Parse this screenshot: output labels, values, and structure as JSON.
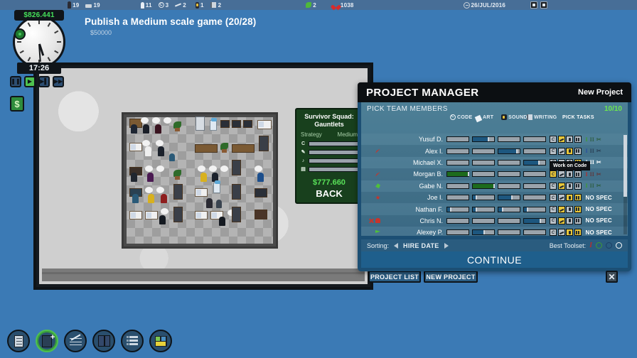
{
  "topbar": {
    "stats": [
      {
        "icon": "person-dark-icon",
        "value": "19"
      },
      {
        "icon": "bed-icon",
        "value": "19"
      },
      {
        "icon": "person-white-icon",
        "value": "11"
      },
      {
        "icon": "code-icon",
        "value": "3"
      },
      {
        "icon": "art-brush-icon",
        "value": "2"
      },
      {
        "icon": "sound-mic-icon",
        "value": "1"
      },
      {
        "icon": "writing-book-icon",
        "value": "2"
      },
      {
        "icon": "leaf-green-icon",
        "value": "2"
      },
      {
        "icon": "heart-red-icon",
        "value": "1038"
      }
    ],
    "date_icon": "clock-circle-icon",
    "date": "26/JUL/2016",
    "right_icons": [
      "save-icon",
      "book-icon"
    ]
  },
  "hud": {
    "money": "$826.441",
    "time": "17:26",
    "speed_buttons": [
      {
        "name": "pause-button",
        "glyph": "❚❚",
        "active": false
      },
      {
        "name": "play-button",
        "glyph": "▶",
        "active": true
      },
      {
        "name": "fast-button",
        "glyph": "▶▌",
        "active": false
      },
      {
        "name": "fastest-button",
        "glyph": "▶▶",
        "active": false
      }
    ],
    "finance_button": "$"
  },
  "objective": {
    "title": "Publish a Medium scale game (20/28)",
    "reward": "$50000"
  },
  "squad": {
    "title_line1": "Survivor Squad:",
    "title_line2": "Gauntlets",
    "genre_label": "Strategy",
    "size_label": "Medium",
    "skills": [
      {
        "label": "C",
        "icon": "code-icon",
        "pct": 52
      },
      {
        "label": "",
        "icon": "art-icon",
        "pct": 12
      },
      {
        "label": "",
        "icon": "sound-icon",
        "pct": 22
      },
      {
        "label": "",
        "icon": "writing-icon",
        "pct": 26
      }
    ],
    "money": "$777.660",
    "back_label": "BACK"
  },
  "project_manager": {
    "title": "PROJECT MANAGER",
    "new_project_label": "New Project",
    "section_label": "PICK TEAM MEMBERS",
    "count": "10/10",
    "columns": [
      {
        "key": "code",
        "label": "CODE",
        "icon": "code-icon"
      },
      {
        "key": "art",
        "label": "ART",
        "icon": "art-brush-icon"
      },
      {
        "key": "sound",
        "label": "SOUND",
        "icon": "sound-mic-icon"
      },
      {
        "key": "writing",
        "label": "WRITING",
        "icon": "writing-book-icon"
      }
    ],
    "pick_tasks_label": "PICK TASKS",
    "tooltip": "Work on Code",
    "members": [
      {
        "name": "Yusuf D.",
        "markers": [],
        "bars": [
          {
            "pct": 0,
            "color": "none"
          },
          {
            "pct": 72,
            "color": "blue"
          },
          {
            "pct": 0,
            "color": "none"
          },
          {
            "pct": 0,
            "color": "none"
          }
        ],
        "tasks": [
          false,
          true,
          false,
          false
        ],
        "spec": {
          "type": "levels",
          "levels": [
            "on",
            "off",
            "off"
          ],
          "color": "green"
        }
      },
      {
        "name": "Alex I.",
        "markers": [
          "rocket"
        ],
        "bars": [
          {
            "pct": 0,
            "color": "none"
          },
          {
            "pct": 0,
            "color": "none"
          },
          {
            "pct": 88,
            "color": "blue"
          },
          {
            "pct": 0,
            "color": "none"
          }
        ],
        "tasks": [
          false,
          false,
          true,
          false
        ],
        "spec": {
          "type": "levels",
          "levels": [
            "on",
            "off",
            "off"
          ],
          "color": "blue"
        }
      },
      {
        "name": "Michael X.",
        "markers": [],
        "bars": [
          {
            "pct": 0,
            "color": "none"
          },
          {
            "pct": 0,
            "color": "none"
          },
          {
            "pct": 0,
            "color": "none"
          },
          {
            "pct": 70,
            "color": "blue"
          }
        ],
        "tasks": [
          false,
          false,
          false,
          true
        ],
        "spec": {
          "type": "levels",
          "levels": [
            "on",
            "on",
            "on"
          ],
          "color": "white"
        }
      },
      {
        "name": "Morgan B.",
        "markers": [
          "rocket"
        ],
        "bars": [
          {
            "pct": 100,
            "color": "green"
          },
          {
            "pct": 0,
            "color": "none"
          },
          {
            "pct": 0,
            "color": "none"
          },
          {
            "pct": 0,
            "color": "none"
          }
        ],
        "tasks": [
          true,
          false,
          false,
          false
        ],
        "spec": {
          "type": "levels",
          "levels": [
            "on",
            "off",
            "off"
          ],
          "color": "red"
        }
      },
      {
        "name": "Gabe N.",
        "markers": [
          "leaf"
        ],
        "bars": [
          {
            "pct": 0,
            "color": "none"
          },
          {
            "pct": 100,
            "color": "green"
          },
          {
            "pct": 0,
            "color": "none"
          },
          {
            "pct": 0,
            "color": "none"
          }
        ],
        "tasks": [
          false,
          true,
          false,
          false
        ],
        "spec": {
          "type": "levels",
          "levels": [
            "on",
            "off",
            "off"
          ],
          "color": "green"
        }
      },
      {
        "name": "Joe I.",
        "markers": [
          "star"
        ],
        "bars": [
          {
            "pct": 0,
            "color": "none"
          },
          {
            "pct": 18,
            "color": "blue"
          },
          {
            "pct": 62,
            "color": "blue"
          },
          {
            "pct": 0,
            "color": "none"
          }
        ],
        "tasks": [
          false,
          false,
          true,
          true
        ],
        "spec": {
          "type": "nospec",
          "label": "NO SPEC"
        }
      },
      {
        "name": "Nathan F.",
        "markers": [],
        "bars": [
          {
            "pct": 16,
            "color": "blue"
          },
          {
            "pct": 18,
            "color": "blue"
          },
          {
            "pct": 20,
            "color": "blue"
          },
          {
            "pct": 18,
            "color": "blue"
          }
        ],
        "tasks": [
          false,
          true,
          false,
          true
        ],
        "spec": {
          "type": "nospec",
          "label": "NO SPEC"
        }
      },
      {
        "name": "Chris N.",
        "markers": [
          "x",
          "ghost"
        ],
        "bars": [
          {
            "pct": 0,
            "color": "none"
          },
          {
            "pct": 0,
            "color": "none"
          },
          {
            "pct": 0,
            "color": "none"
          },
          {
            "pct": 78,
            "color": "blue"
          }
        ],
        "tasks": [
          false,
          true,
          false,
          false
        ],
        "spec": {
          "type": "nospec",
          "label": "NO SPEC"
        }
      },
      {
        "name": "Alexey P.",
        "markers": [
          "flag"
        ],
        "bars": [
          {
            "pct": 0,
            "color": "none"
          },
          {
            "pct": 52,
            "color": "blue"
          },
          {
            "pct": 0,
            "color": "none"
          },
          {
            "pct": 0,
            "color": "none"
          }
        ],
        "tasks": [
          false,
          false,
          true,
          true
        ],
        "spec": {
          "type": "nospec",
          "label": "NO SPEC"
        }
      }
    ],
    "sorting_label": "Sorting:",
    "sorting_value": "HIRE DATE",
    "toolset_label": "Best Toolset:",
    "toolset_marks": [
      {
        "name": "toolset-i",
        "kind": "roman",
        "color": "#b33030"
      },
      {
        "name": "toolset-green",
        "kind": "ring",
        "color": "#3f9b33"
      },
      {
        "name": "toolset-blue",
        "kind": "ring",
        "color": "#1d3f66"
      },
      {
        "name": "toolset-white",
        "kind": "ring",
        "color": "#ffffff"
      }
    ],
    "continue_label": "CONTINUE"
  },
  "bottom_buttons": {
    "project_list": "PROJECT LIST",
    "new_project": "NEW PROJECT",
    "close": "✕"
  },
  "toolbar": [
    {
      "name": "reports-button",
      "icon": "document-icon",
      "highlight": false
    },
    {
      "name": "new-item-button",
      "icon": "add-doc-icon",
      "highlight": true
    },
    {
      "name": "stats-button",
      "icon": "chart-icon",
      "highlight": false
    },
    {
      "name": "research-button",
      "icon": "book-icon",
      "highlight": false
    },
    {
      "name": "staff-button",
      "icon": "list-icon",
      "highlight": false
    },
    {
      "name": "build-button",
      "icon": "grid-icon",
      "highlight": false
    }
  ]
}
